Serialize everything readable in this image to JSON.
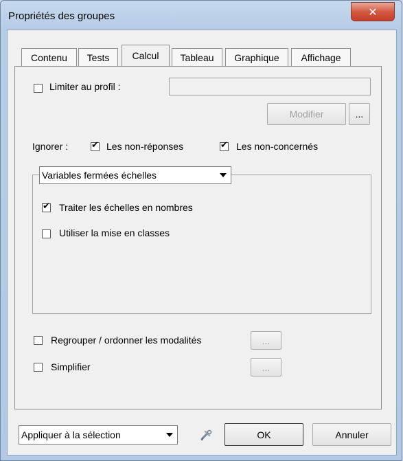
{
  "window": {
    "title": "Propriétés des groupes"
  },
  "tabs": [
    {
      "label": "Contenu"
    },
    {
      "label": "Tests"
    },
    {
      "label": "Calcul"
    },
    {
      "label": "Tableau"
    },
    {
      "label": "Graphique"
    },
    {
      "label": "Affichage"
    }
  ],
  "active_tab": "Calcul",
  "limit_profile": {
    "label": "Limiter au profil :",
    "checked": false,
    "value": ""
  },
  "modify_button": {
    "label": "Modifier",
    "ellipsis": "..."
  },
  "ignore": {
    "label": "Ignorer :",
    "non_responses": {
      "label": "Les non-réponses",
      "checked": true
    },
    "non_concerned": {
      "label": "Les non-concernés",
      "checked": true
    }
  },
  "variables_combo": {
    "value": "Variables fermées échelles"
  },
  "scales_numbers": {
    "label": "Traiter les échelles en nombres",
    "checked": true
  },
  "use_classes": {
    "label": "Utiliser la mise en classes",
    "checked": false
  },
  "regroup": {
    "label": "Regrouper / ordonner les modalités",
    "checked": false,
    "button": "..."
  },
  "simplify": {
    "label": "Simplifier",
    "checked": false,
    "button": "..."
  },
  "footer": {
    "apply_combo": "Appliquer à la sélection",
    "ok": "OK",
    "cancel": "Annuler"
  },
  "icons": {
    "close": "close-icon",
    "tool": "tools-icon"
  }
}
